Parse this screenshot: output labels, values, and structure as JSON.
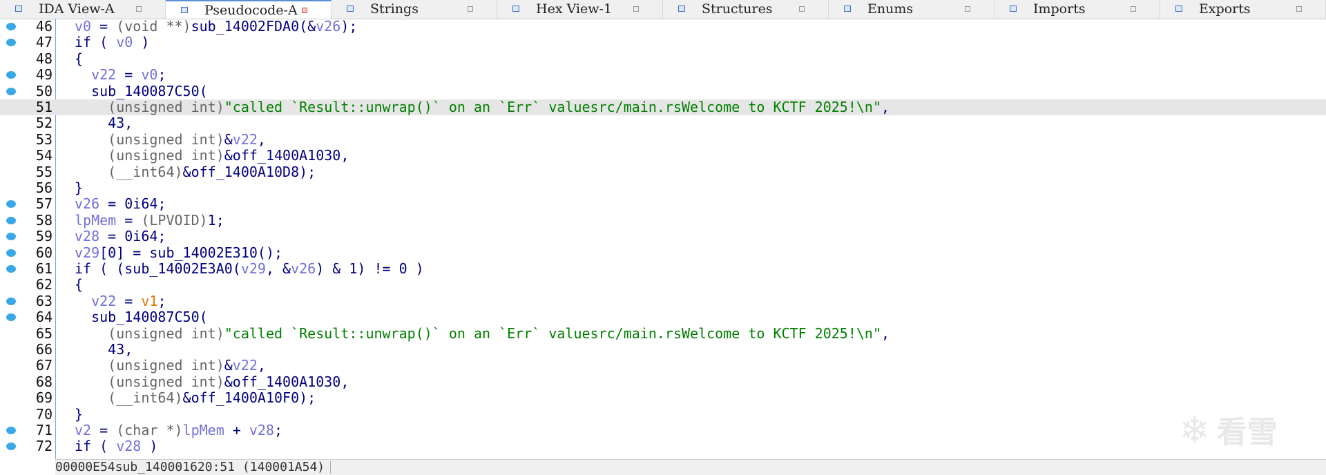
{
  "tabs": [
    {
      "label": "IDA View-A",
      "active": false
    },
    {
      "label": "Pseudocode-A",
      "active": true
    },
    {
      "label": "Strings",
      "active": false
    },
    {
      "label": "Hex View-1",
      "active": false
    },
    {
      "label": "Structures",
      "active": false
    },
    {
      "label": "Enums",
      "active": false
    },
    {
      "label": "Imports",
      "active": false
    },
    {
      "label": "Exports",
      "active": false
    }
  ],
  "code_lines": [
    {
      "num": "46",
      "dot": true,
      "tokens": [
        [
          "v",
          "v0"
        ],
        [
          "k",
          " = "
        ],
        [
          "g",
          "(void **)"
        ],
        [
          "k",
          "sub_14002FDA0(&"
        ],
        [
          "v",
          "v26"
        ],
        [
          "k",
          ");"
        ]
      ]
    },
    {
      "num": "47",
      "dot": true,
      "tokens": [
        [
          "k",
          "if ( "
        ],
        [
          "v",
          "v0"
        ],
        [
          "k",
          " )"
        ]
      ]
    },
    {
      "num": "48",
      "dot": false,
      "tokens": [
        [
          "k",
          "{"
        ]
      ]
    },
    {
      "num": "49",
      "dot": true,
      "tokens": [
        [
          "k",
          "  "
        ],
        [
          "v",
          "v22"
        ],
        [
          "k",
          " = "
        ],
        [
          "v",
          "v0"
        ],
        [
          "k",
          ";"
        ]
      ]
    },
    {
      "num": "50",
      "dot": true,
      "tokens": [
        [
          "k",
          "  sub_140087C50("
        ]
      ]
    },
    {
      "num": "51",
      "dot": false,
      "hl": true,
      "tokens": [
        [
          "k",
          "    "
        ],
        [
          "g",
          "(unsigned int)"
        ],
        [
          "s",
          "\"called `Result::unwrap()` on an `Err` valuesrc/main.rsWelcome to KCTF 2025!\\n\""
        ],
        [
          "k",
          ","
        ]
      ]
    },
    {
      "num": "52",
      "dot": false,
      "tokens": [
        [
          "k",
          "    43,"
        ]
      ]
    },
    {
      "num": "53",
      "dot": false,
      "tokens": [
        [
          "k",
          "    "
        ],
        [
          "g",
          "(unsigned int)"
        ],
        [
          "k",
          "&"
        ],
        [
          "v",
          "v22"
        ],
        [
          "k",
          ","
        ]
      ]
    },
    {
      "num": "54",
      "dot": false,
      "tokens": [
        [
          "k",
          "    "
        ],
        [
          "g",
          "(unsigned int)"
        ],
        [
          "k",
          "&off_1400A1030,"
        ]
      ]
    },
    {
      "num": "55",
      "dot": false,
      "tokens": [
        [
          "k",
          "    "
        ],
        [
          "g",
          "(__int64)"
        ],
        [
          "k",
          "&off_1400A10D8);"
        ]
      ]
    },
    {
      "num": "56",
      "dot": false,
      "tokens": [
        [
          "k",
          "}"
        ]
      ]
    },
    {
      "num": "57",
      "dot": true,
      "tokens": [
        [
          "v",
          "v26"
        ],
        [
          "k",
          " = 0i64;"
        ]
      ]
    },
    {
      "num": "58",
      "dot": true,
      "tokens": [
        [
          "v",
          "lpMem"
        ],
        [
          "k",
          " = "
        ],
        [
          "g",
          "(LPVOID)"
        ],
        [
          "k",
          "1;"
        ]
      ]
    },
    {
      "num": "59",
      "dot": true,
      "tokens": [
        [
          "v",
          "v28"
        ],
        [
          "k",
          " = 0i64;"
        ]
      ]
    },
    {
      "num": "60",
      "dot": true,
      "tokens": [
        [
          "v",
          "v29"
        ],
        [
          "k",
          "[0] = sub_14002E310();"
        ]
      ]
    },
    {
      "num": "61",
      "dot": true,
      "tokens": [
        [
          "k",
          "if ( (sub_14002E3A0("
        ],
        [
          "v",
          "v29"
        ],
        [
          "k",
          ", &"
        ],
        [
          "v",
          "v26"
        ],
        [
          "k",
          ") & 1) != 0 )"
        ]
      ]
    },
    {
      "num": "62",
      "dot": false,
      "tokens": [
        [
          "k",
          "{"
        ]
      ]
    },
    {
      "num": "63",
      "dot": true,
      "tokens": [
        [
          "k",
          "  "
        ],
        [
          "v",
          "v22"
        ],
        [
          "k",
          " = "
        ],
        [
          "o",
          "v1"
        ],
        [
          "k",
          ";"
        ]
      ]
    },
    {
      "num": "64",
      "dot": true,
      "tokens": [
        [
          "k",
          "  sub_140087C50("
        ]
      ]
    },
    {
      "num": "65",
      "dot": false,
      "tokens": [
        [
          "k",
          "    "
        ],
        [
          "g",
          "(unsigned int)"
        ],
        [
          "s",
          "\"called `Result::unwrap()` on an `Err` valuesrc/main.rsWelcome to KCTF 2025!\\n\""
        ],
        [
          "k",
          ","
        ]
      ]
    },
    {
      "num": "66",
      "dot": false,
      "tokens": [
        [
          "k",
          "    43,"
        ]
      ]
    },
    {
      "num": "67",
      "dot": false,
      "tokens": [
        [
          "k",
          "    "
        ],
        [
          "g",
          "(unsigned int)"
        ],
        [
          "k",
          "&"
        ],
        [
          "v",
          "v22"
        ],
        [
          "k",
          ","
        ]
      ]
    },
    {
      "num": "68",
      "dot": false,
      "tokens": [
        [
          "k",
          "    "
        ],
        [
          "g",
          "(unsigned int)"
        ],
        [
          "k",
          "&off_1400A1030,"
        ]
      ]
    },
    {
      "num": "69",
      "dot": false,
      "tokens": [
        [
          "k",
          "    "
        ],
        [
          "g",
          "(__int64)"
        ],
        [
          "k",
          "&off_1400A10F0);"
        ]
      ]
    },
    {
      "num": "70",
      "dot": false,
      "tokens": [
        [
          "k",
          "}"
        ]
      ]
    },
    {
      "num": "71",
      "dot": true,
      "tokens": [
        [
          "v",
          "v2"
        ],
        [
          "k",
          " = "
        ],
        [
          "g",
          "(char *)"
        ],
        [
          "v",
          "lpMem"
        ],
        [
          "k",
          " + "
        ],
        [
          "v",
          "v28"
        ],
        [
          "k",
          ";"
        ]
      ]
    },
    {
      "num": "72",
      "dot": true,
      "tokens": [
        [
          "k",
          "if ( "
        ],
        [
          "v",
          "v28"
        ],
        [
          "k",
          " )"
        ]
      ]
    }
  ],
  "status": {
    "offset": "00000E54",
    "location": "sub_140001620:51 (140001A54)"
  },
  "watermark": {
    "text": "看雪",
    "icon": "snowflake-icon"
  },
  "colors": {
    "keyword": "#000080",
    "variable": "#7070d8",
    "cast": "#666666",
    "string": "#008000",
    "global": "#e67700",
    "breakpoint_dot": "#3aa8e6",
    "current_line": "#e6e6e6"
  }
}
